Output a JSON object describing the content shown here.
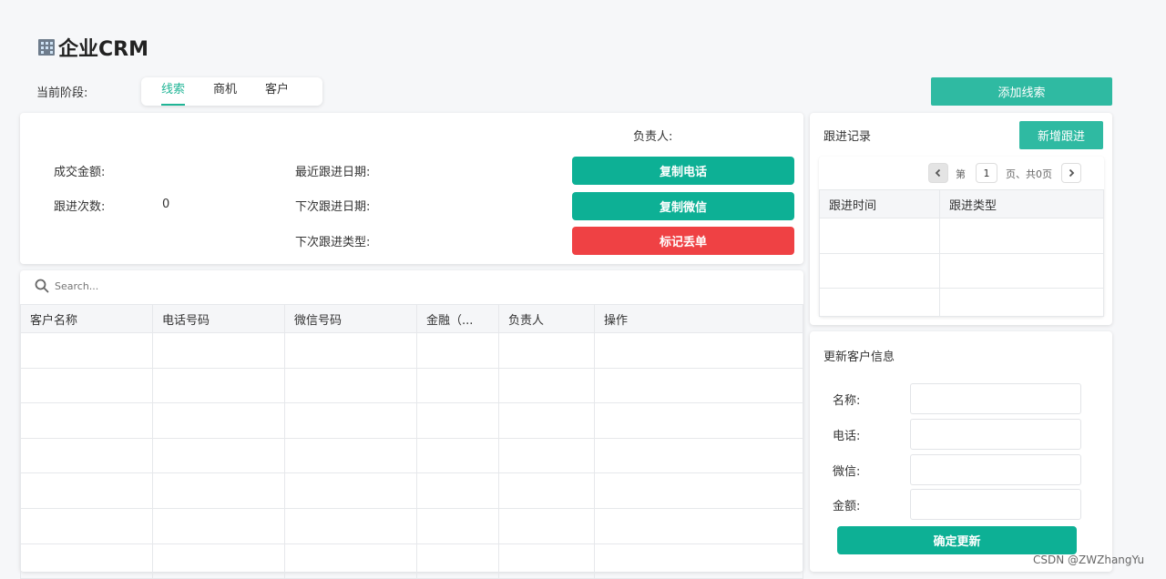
{
  "app": {
    "title": "企业CRM"
  },
  "stage": {
    "label": "当前阶段:",
    "tabs": [
      {
        "label": "线索",
        "active": true
      },
      {
        "label": "商机",
        "active": false
      },
      {
        "label": "客户",
        "active": false
      }
    ]
  },
  "actions": {
    "add_lead": "添加线索"
  },
  "info": {
    "owner_label": "负责人:",
    "deal_amount_label": "成交金额:",
    "follow_count_label": "跟进次数:",
    "follow_count_value": "0",
    "last_follow_label": "最近跟进日期:",
    "next_follow_label": "下次跟进日期:",
    "next_type_label": "下次跟进类型:",
    "copy_phone": "复制电话",
    "copy_wechat": "复制微信",
    "mark_lost": "标记丢单"
  },
  "search": {
    "placeholder": "Search..."
  },
  "main_table": {
    "columns": [
      "客户名称",
      "电话号码",
      "微信号码",
      "金融（...",
      "负责人",
      "操作"
    ]
  },
  "follow_up": {
    "title": "跟进记录",
    "add_button": "新增跟进",
    "pagination": {
      "prefix": "第",
      "page": "1",
      "suffix": "页、共0页"
    },
    "columns": [
      "跟进时间",
      "跟进类型"
    ]
  },
  "update_form": {
    "title": "更新客户信息",
    "fields": [
      {
        "label": "名称:",
        "value": ""
      },
      {
        "label": "电话:",
        "value": ""
      },
      {
        "label": "微信:",
        "value": ""
      },
      {
        "label": "金额:",
        "value": ""
      }
    ],
    "submit": "确定更新"
  },
  "watermark": "CSDN @ZWZhangYu",
  "colors": {
    "accent": "#0db095",
    "danger": "#ef4144",
    "button_light": "#2fbaa2"
  }
}
